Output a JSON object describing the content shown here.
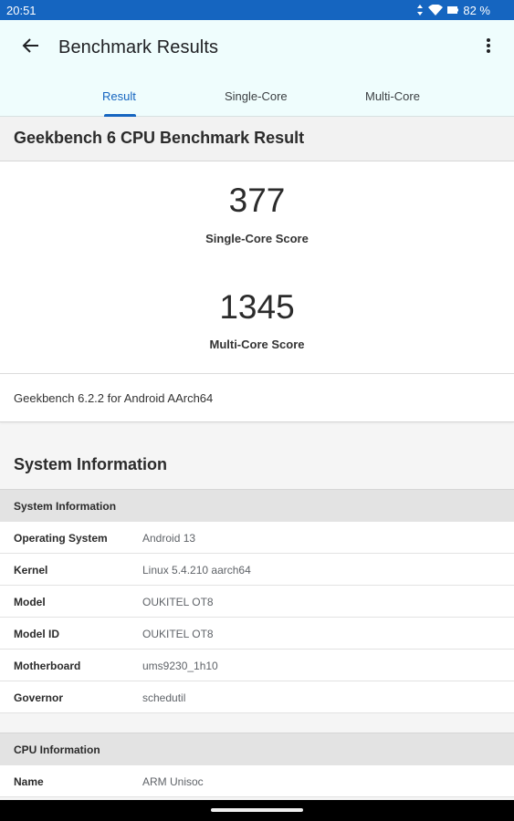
{
  "status_bar": {
    "time": "20:51",
    "battery": "82 %"
  },
  "app_bar": {
    "title": "Benchmark Results"
  },
  "tabs": [
    {
      "label": "Result",
      "active": true
    },
    {
      "label": "Single-Core",
      "active": false
    },
    {
      "label": "Multi-Core",
      "active": false
    }
  ],
  "result": {
    "heading": "Geekbench 6 CPU Benchmark Result",
    "single_core_score": "377",
    "single_core_label": "Single-Core Score",
    "multi_core_score": "1345",
    "multi_core_label": "Multi-Core Score",
    "version": "Geekbench 6.2.2 for Android AArch64"
  },
  "system_information": {
    "title": "System Information",
    "table_heading": "System Information",
    "rows": [
      {
        "key": "Operating System",
        "value": "Android 13"
      },
      {
        "key": "Kernel",
        "value": "Linux 5.4.210 aarch64"
      },
      {
        "key": "Model",
        "value": "OUKITEL OT8"
      },
      {
        "key": "Model ID",
        "value": "OUKITEL OT8"
      },
      {
        "key": "Motherboard",
        "value": "ums9230_1h10"
      },
      {
        "key": "Governor",
        "value": "schedutil"
      }
    ]
  },
  "cpu_information": {
    "table_heading": "CPU Information",
    "rows": [
      {
        "key": "Name",
        "value": "ARM Unisoc"
      }
    ]
  },
  "colors": {
    "accent": "#1565c0",
    "status_bar": "#1565c0",
    "app_bar": "#effdfd"
  },
  "icons": [
    "back-arrow-icon",
    "more-vert-icon",
    "signal-icon",
    "wifi-icon",
    "battery-icon"
  ]
}
